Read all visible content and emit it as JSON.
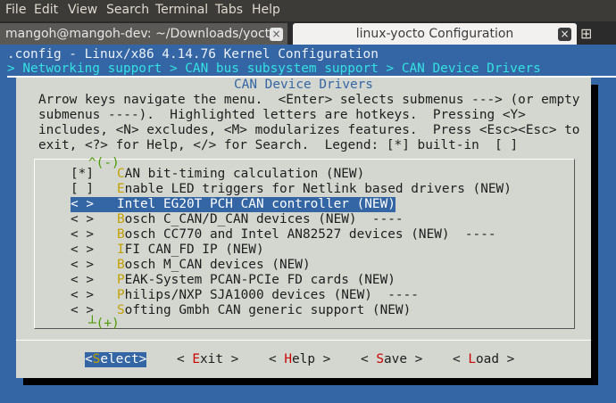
{
  "menubar": {
    "items": [
      "File",
      "Edit",
      "View",
      "Search",
      "Terminal",
      "Tabs",
      "Help"
    ]
  },
  "tabs": [
    {
      "label": "mangoh@mangoh-dev: ~/Downloads/yoct...",
      "close": "×"
    },
    {
      "label": "linux-yocto Configuration",
      "close": "×"
    }
  ],
  "new_tab_icon": "⊞",
  "terminal": {
    "config_title": ".config - Linux/x86 4.14.76 Kernel Configuration",
    "breadcrumb": "> Networking support > CAN bus subsystem support > CAN Device Drivers",
    "dialog_title": " CAN Device Drivers ",
    "help_lines": [
      "Arrow keys navigate the menu.  <Enter> selects submenus ---> (or empty",
      "submenus ----).  Highlighted letters are hotkeys.  Pressing <Y>",
      "includes, <N> excludes, <M> modularizes features.  Press <Esc><Esc> to",
      "exit, <?> for Help, </> for Search.  Legend: [*] built-in  [ ]"
    ],
    "scroll_up": "^(-)",
    "scroll_down": "┴(+)",
    "items": [
      {
        "mark": "[*]",
        "hot": "C",
        "rest": "AN bit-timing calculation (NEW)",
        "selected": false
      },
      {
        "mark": "[ ]",
        "hot": "E",
        "rest": "nable LED triggers for Netlink based drivers (NEW)",
        "selected": false
      },
      {
        "mark": "< >",
        "hot": "I",
        "rest": "ntel EG20T PCH CAN controller (NEW)",
        "selected": true
      },
      {
        "mark": "< >",
        "hot": "B",
        "rest": "osch C_CAN/D_CAN devices (NEW)  ----",
        "selected": false
      },
      {
        "mark": "< >",
        "hot": "B",
        "rest": "osch CC770 and Intel AN82527 devices (NEW)  ----",
        "selected": false
      },
      {
        "mark": "< >",
        "hot": "I",
        "rest": "FI CAN_FD IP (NEW)",
        "selected": false
      },
      {
        "mark": "< >",
        "hot": "B",
        "rest": "osch M_CAN devices (NEW)",
        "selected": false
      },
      {
        "mark": "< >",
        "hot": "P",
        "rest": "EAK-System PCAN-PCIe FD cards (NEW)",
        "selected": false
      },
      {
        "mark": "< >",
        "hot": "P",
        "rest": "hilips/NXP SJA1000 devices (NEW)  ----",
        "selected": false
      },
      {
        "mark": "< >",
        "hot": "S",
        "rest": "ofting Gmbh CAN generic support (NEW)",
        "selected": false
      }
    ],
    "buttons": [
      {
        "pre": "<",
        "hot": "S",
        "rest": "elect>",
        "active": true
      },
      {
        "pre": "< ",
        "hot": "E",
        "rest": "xit >",
        "active": false
      },
      {
        "pre": "< ",
        "hot": "H",
        "rest": "elp >",
        "active": false
      },
      {
        "pre": "< ",
        "hot": "S",
        "rest": "ave >",
        "active": false
      },
      {
        "pre": "< ",
        "hot": "L",
        "rest": "oad >",
        "active": false
      }
    ]
  },
  "colors": {
    "terminal_bg": "#3465a4",
    "dialog_bg": "#d3d7cf",
    "breadcrumb": "#34e2e2",
    "hotkey": "#c4a000",
    "selection": "#3465a4"
  }
}
